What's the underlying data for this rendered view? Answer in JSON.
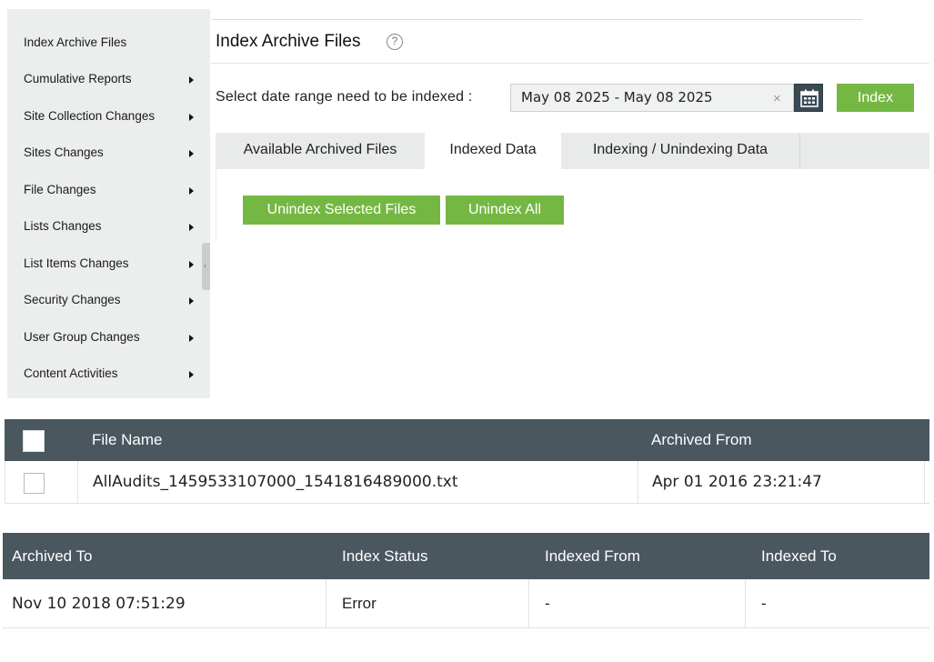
{
  "sidebar": {
    "items": [
      {
        "label": "Index Archive Files",
        "has_arrow": false
      },
      {
        "label": "Cumulative Reports",
        "has_arrow": true
      },
      {
        "label": "Site Collection Changes",
        "has_arrow": true
      },
      {
        "label": "Sites Changes",
        "has_arrow": true
      },
      {
        "label": "File Changes",
        "has_arrow": true
      },
      {
        "label": "Lists Changes",
        "has_arrow": true
      },
      {
        "label": "List Items Changes",
        "has_arrow": true
      },
      {
        "label": "Security Changes",
        "has_arrow": true
      },
      {
        "label": "User Group Changes",
        "has_arrow": true
      },
      {
        "label": "Content Activities",
        "has_arrow": true
      }
    ]
  },
  "header": {
    "title": "Index Archive Files",
    "help_glyph": "?"
  },
  "range": {
    "label": "Select date range need to be indexed :",
    "value": "May 08 2025 - May 08 2025",
    "clear_glyph": "×",
    "index_label": "Index"
  },
  "tabs": [
    {
      "label": "Available Archived Files",
      "active": false
    },
    {
      "label": "Indexed Data",
      "active": true
    },
    {
      "label": "Indexing / Unindexing Data",
      "active": false
    }
  ],
  "actions": {
    "unindex_selected": "Unindex Selected Files",
    "unindex_all": "Unindex All"
  },
  "table1": {
    "headers": [
      "File Name",
      "Archived From"
    ],
    "rows": [
      {
        "file_name": "AllAudits_1459533107000_1541816489000.txt",
        "archived_from": "Apr 01 2016 23:21:47"
      }
    ]
  },
  "table2": {
    "headers": [
      "Archived To",
      "Index Status",
      "Indexed From",
      "Indexed To"
    ],
    "rows": [
      {
        "archived_to": "Nov 10 2018 07:51:29",
        "index_status": "Error",
        "indexed_from": "-",
        "indexed_to": "-"
      }
    ]
  },
  "colors": {
    "accent_green": "#74b843",
    "table_header": "#4a575f",
    "sidebar_bg": "#eceeee"
  }
}
